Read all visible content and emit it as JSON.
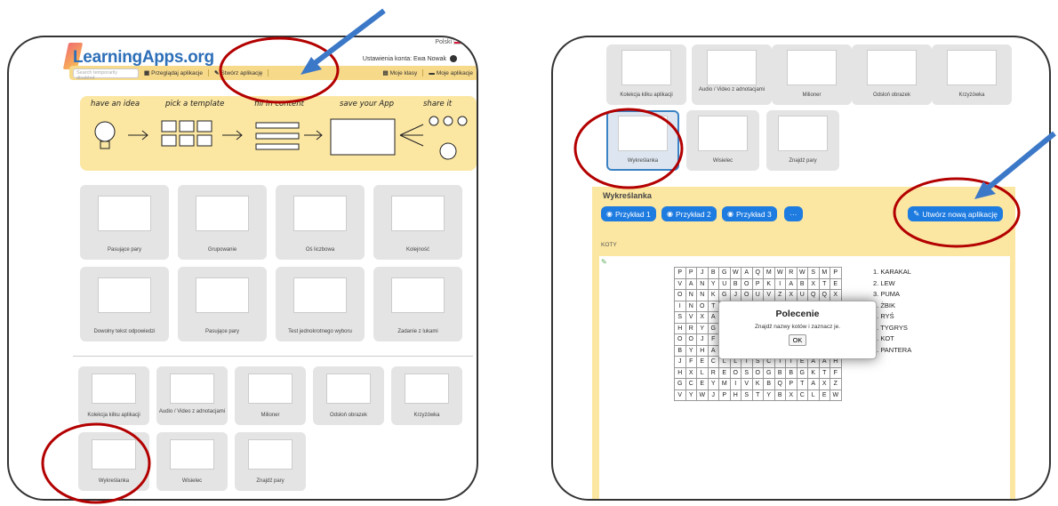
{
  "left": {
    "logo": "LearningApps.org",
    "language": "Polski",
    "account": "Ustawienia konta: Ewa Nowak",
    "search_placeholder": "Search temporarily disabled",
    "nav": [
      "Przeglądaj aplikacje",
      "Stwórz aplikację",
      "Moje klasy",
      "Moje aplikacje"
    ],
    "steps": [
      "have an idea",
      "pick a template",
      "fill in content",
      "save your App",
      "share it"
    ],
    "templates_row1": [
      "Pasujące pary",
      "Grupowanie",
      "Oś liczbowa",
      "Kolejność"
    ],
    "templates_row2": [
      "Dowolny tekst odpowiedzi",
      "Pasujące pary",
      "Test jednokrotnego wyboru",
      "Zadanie z lukami"
    ],
    "templates_row3": [
      "Kolekcja kilku aplikacji",
      "Audio / Video z adnotacjami",
      "Milioner",
      "Odsłoń obrazek",
      "Krzyżówka"
    ],
    "templates_row4": [
      "Wykreślanka",
      "Wisielec",
      "Znajdź pary"
    ]
  },
  "right": {
    "templates_row1": [
      "Kolekcja kilku aplikacji",
      "Audio / Video z adnotacjami",
      "Milioner",
      "Odsłoń obrazek",
      "Krzyżówka"
    ],
    "templates_row2": [
      "Wykreślanka",
      "Wisielec",
      "Znajdź pary"
    ],
    "app_title": "Wykreślanka",
    "examples": [
      "Przykład 1",
      "Przykład 2",
      "Przykład 3"
    ],
    "more": "···",
    "create_new": "Utwórz nową aplikację",
    "category": "KOTY",
    "grid": [
      [
        "P",
        "P",
        "J",
        "B",
        "G",
        "W",
        "A",
        "Q",
        "M",
        "W",
        "R",
        "W",
        "S",
        "M",
        "P"
      ],
      [
        "V",
        "A",
        "N",
        "Y",
        "U",
        "B",
        "O",
        "P",
        "K",
        "I",
        "A",
        "B",
        "X",
        "T",
        "E"
      ],
      [
        "O",
        "N",
        "N",
        "K",
        "G",
        "J",
        "O",
        "U",
        "V",
        "Z",
        "X",
        "U",
        "Q",
        "Q",
        "X"
      ],
      [
        "I",
        "N",
        "O",
        "T",
        "",
        "",
        "",
        "",
        "",
        "",
        "",
        "",
        "",
        "",
        ""
      ],
      [
        "S",
        "V",
        "X",
        "A",
        "",
        "",
        "",
        "",
        "",
        "",
        "",
        "",
        "",
        "",
        ""
      ],
      [
        "H",
        "R",
        "Y",
        "G",
        "",
        "",
        "",
        "",
        "",
        "",
        "",
        "",
        "",
        "",
        ""
      ],
      [
        "O",
        "O",
        "J",
        "F",
        "",
        "",
        "",
        "",
        "",
        "",
        "",
        "",
        "",
        "",
        ""
      ],
      [
        "B",
        "Y",
        "H",
        "A",
        "",
        "",
        "",
        "",
        "",
        "",
        "",
        "",
        "",
        "",
        ""
      ],
      [
        "J",
        "F",
        "E",
        "C",
        "L",
        "L",
        "T",
        "S",
        "C",
        "T",
        "T",
        "E",
        "A",
        "A",
        "H"
      ],
      [
        "H",
        "X",
        "L",
        "R",
        "E",
        "O",
        "S",
        "O",
        "G",
        "B",
        "B",
        "G",
        "K",
        "T",
        "F"
      ],
      [
        "G",
        "C",
        "E",
        "Y",
        "M",
        "I",
        "V",
        "K",
        "B",
        "Q",
        "P",
        "T",
        "A",
        "X",
        "Z"
      ],
      [
        "V",
        "Y",
        "W",
        "J",
        "P",
        "H",
        "S",
        "T",
        "Y",
        "B",
        "X",
        "C",
        "L",
        "E",
        "W"
      ]
    ],
    "words": [
      "1. KARAKAL",
      "2. LEW",
      "3. PUMA",
      "4. ŻBIK",
      "5. RYŚ",
      "6. TYGRYS",
      "7. KOT",
      "8. PANTERA"
    ],
    "modal": {
      "title": "Polecenie",
      "text": "Znajdź nazwy kotów i zaznacz je.",
      "ok": "OK"
    }
  },
  "colors": {
    "banner": "#fbe6a2",
    "accent": "#1e7be0",
    "annotation_red": "#b30000",
    "arrow_blue": "#3c78c8"
  }
}
